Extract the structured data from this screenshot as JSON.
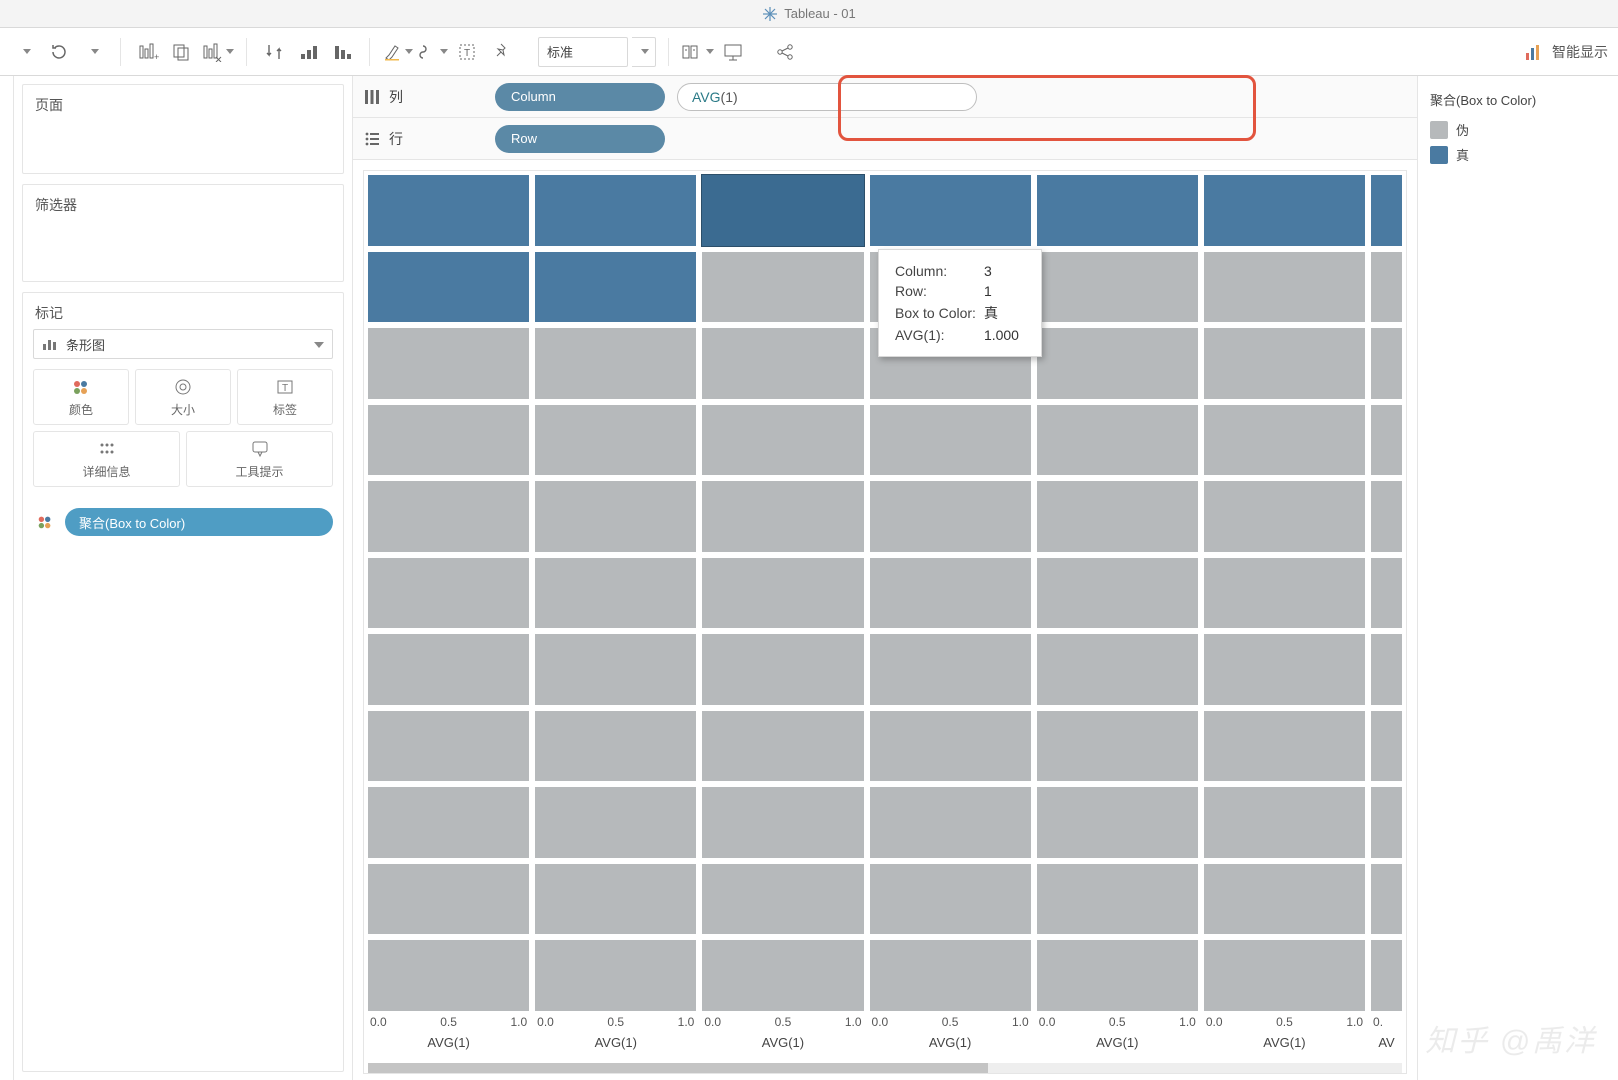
{
  "window": {
    "title": "Tableau - 01"
  },
  "toolbar": {
    "fit_mode": "标准",
    "smart_show": "智能显示"
  },
  "left": {
    "pages_title": "页面",
    "filters_title": "筛选器",
    "marks_title": "标记",
    "mark_type": "条形图",
    "mark_cells": {
      "color": "颜色",
      "size": "大小",
      "label": "标签",
      "detail": "详细信息",
      "tooltip": "工具提示"
    },
    "color_pill": "聚合(Box to Color)"
  },
  "shelves": {
    "columns_label": "列",
    "rows_label": "行",
    "column_pill": "Column",
    "row_pill": "Row",
    "avg_field_fn": "AVG",
    "avg_field_arg": "(1)"
  },
  "tooltip": {
    "column_k": "Column:",
    "column_v": "3",
    "row_k": "Row:",
    "row_v": "1",
    "btc_k": "Box to Color:",
    "btc_v": "真",
    "avg_k": "AVG(1):",
    "avg_v": "1.000"
  },
  "legend": {
    "title": "聚合(Box to Color)",
    "items": [
      {
        "label": "伪",
        "color": "#b6b9bb"
      },
      {
        "label": "真",
        "color": "#4a7aa1"
      }
    ]
  },
  "axis": {
    "ticks": [
      "0.0",
      "0.5",
      "1.0"
    ],
    "label": "AVG(1)",
    "partial_tick": "0."
  },
  "chart_data": {
    "type": "bar",
    "note": "Small-multiples grid: one cell per (Column,Row); each cell is a single bar AVG(1)=1.000, colored by 聚合(Box to Color).",
    "columns_visible": 7,
    "rows_visible": 11,
    "x_measure": "AVG(1)",
    "x_range": [
      0,
      1
    ],
    "x_ticks": [
      0.0,
      0.5,
      1.0
    ],
    "color_field": "聚合(Box to Color)",
    "color_domain": [
      "伪",
      "真"
    ],
    "color_range": [
      "#b6b9bb",
      "#4a7aa1"
    ],
    "true_cells": [
      {
        "row": 1,
        "col": 1
      },
      {
        "row": 1,
        "col": 2
      },
      {
        "row": 1,
        "col": 3
      },
      {
        "row": 1,
        "col": 4
      },
      {
        "row": 1,
        "col": 5
      },
      {
        "row": 1,
        "col": 6
      },
      {
        "row": 1,
        "col": 7
      },
      {
        "row": 2,
        "col": 1
      },
      {
        "row": 2,
        "col": 2
      }
    ],
    "selected_cell": {
      "row": 1,
      "col": 3
    },
    "value_per_cell": 1.0,
    "last_column_partial": true
  },
  "watermark": "知乎 @禹洋"
}
